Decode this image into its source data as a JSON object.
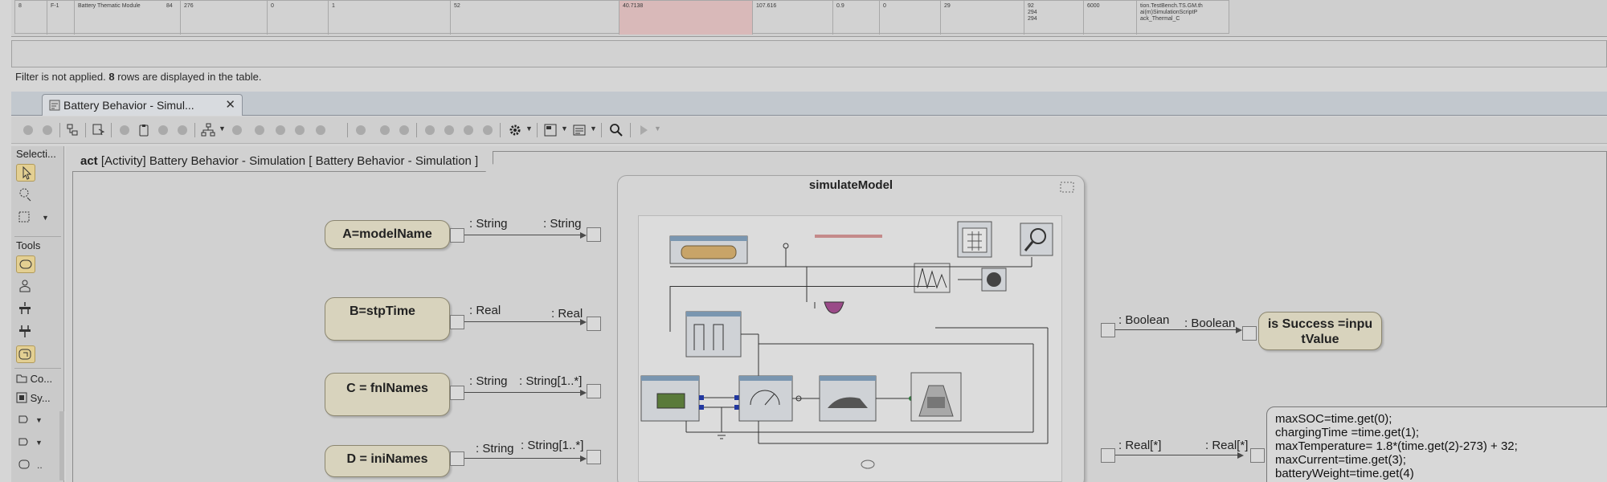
{
  "table": {
    "row": [
      "8",
      "F-1",
      "Battery Thematic Module",
      "84",
      "276",
      "0",
      "1",
      "52",
      "40.7138",
      "107.616",
      "0.9",
      "0",
      "29",
      "92",
      "294",
      "294",
      "6000"
    ],
    "last_cell_lines": [
      "tion.TestBench.TS.GM.th",
      "ai(m)SimulationScriptP",
      "ack_Thermal_C"
    ]
  },
  "filter_status": {
    "prefix": "Filter is not applied.",
    "count": "8",
    "suffix": "rows are displayed in the table."
  },
  "editor_tab": {
    "label": "Battery Behavior - Simul...",
    "close": "✕"
  },
  "palette": {
    "selection_header": "Selecti...",
    "tools_header": "Tools",
    "bottom_items": [
      "Co...",
      "Sy..."
    ]
  },
  "diagram": {
    "frame_kind": "act",
    "frame_name": "[Activity] Battery Behavior - Simulation [ Battery Behavior - Simulation ]",
    "actions": [
      {
        "label": "A=modelName",
        "out_type": ": String",
        "in_type": ": String"
      },
      {
        "label": "B=stpTime",
        "out_type": ": Real",
        "in_type": ": Real"
      },
      {
        "label": "C = fnlNames",
        "out_type": ": String",
        "in_type": ": String[1..*]"
      },
      {
        "label": "D = iniNames",
        "out_type": ": String",
        "in_type": ": String[1..*]"
      }
    ],
    "submodel_title": "simulateModel",
    "success": {
      "label_line1": "is Success =inpu",
      "label_line2": "tValue",
      "in_type": ": Boolean",
      "pin_type": ": Boolean"
    },
    "results": {
      "in_type": ": Real[*]",
      "pin_type": ": Real[*]",
      "code_lines": [
        "maxSOC=time.get(0);",
        "chargingTime =time.get(1);",
        "maxTemperature= 1.8*(time.get(2)-273) + 32;",
        "maxCurrent=time.get(3);",
        "batteryWeight=time.get(4)"
      ]
    }
  },
  "colors": {
    "action_fill": "#d8d3bd",
    "tab_fill": "#d8dbdf",
    "selected_tool": "#e3cf92",
    "highlight_cell": "#d9b9b9"
  }
}
